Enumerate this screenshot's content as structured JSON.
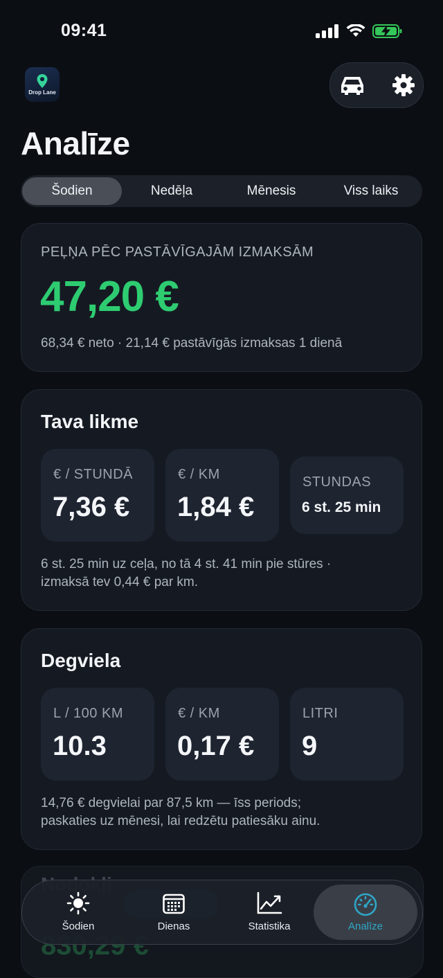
{
  "status": {
    "time": "09:41"
  },
  "app": {
    "logo_text": "Drop Lane"
  },
  "page": {
    "title": "Analīze"
  },
  "period_tabs": [
    {
      "label": "Šodien",
      "active": true
    },
    {
      "label": "Nedēļa",
      "active": false
    },
    {
      "label": "Mēnesis",
      "active": false
    },
    {
      "label": "Viss laiks",
      "active": false
    }
  ],
  "profit": {
    "label": "PEĻŅA PĒC PASTĀVĪGAJĀM IZMAKSĀM",
    "value": "47,20 €",
    "subtitle": "68,34 € neto · 21,14 € pastāvīgās izmaksas 1 dienā",
    "value_color": "#2ecc71"
  },
  "rate": {
    "title": "Tava likme",
    "metrics": [
      {
        "label": "€ / STUNDĀ",
        "value": "7,36 €"
      },
      {
        "label": "€ / KM",
        "value": "1,84 €"
      },
      {
        "label": "STUNDAS",
        "value": "6 st. 25 min"
      }
    ],
    "note_line1": "6 st. 25 min uz ceļa, no tā 4 st. 41 min pie stūres ·",
    "note_line2": "izmaksā tev 0,44 € par km."
  },
  "fuel": {
    "title": "Degviela",
    "metrics": [
      {
        "label": "L / 100 KM",
        "value": "10.3"
      },
      {
        "label": "€ / KM",
        "value": "0,17 €"
      },
      {
        "label": "LITRI",
        "value": "9"
      }
    ],
    "note_line1": "14,76 € degvielai par 87,5 km — īss periods;",
    "note_line2": "paskaties uz mēnesi, lai redzētu patiesāku ainu."
  },
  "ghost_card": {
    "title": "Nodokļi",
    "value": "830,29 €"
  },
  "tab_bar": [
    {
      "label": "Šodien",
      "icon": "sun-icon",
      "active": false
    },
    {
      "label": "Dienas",
      "icon": "calendar-icon",
      "active": false
    },
    {
      "label": "Statistika",
      "icon": "chart-icon",
      "active": false
    },
    {
      "label": "Analīze",
      "icon": "gauge-icon",
      "active": true
    }
  ],
  "colors": {
    "accent": "#2fa6c8",
    "profit": "#2ecc71",
    "background": "#0b0e13",
    "card": "#151a22"
  }
}
